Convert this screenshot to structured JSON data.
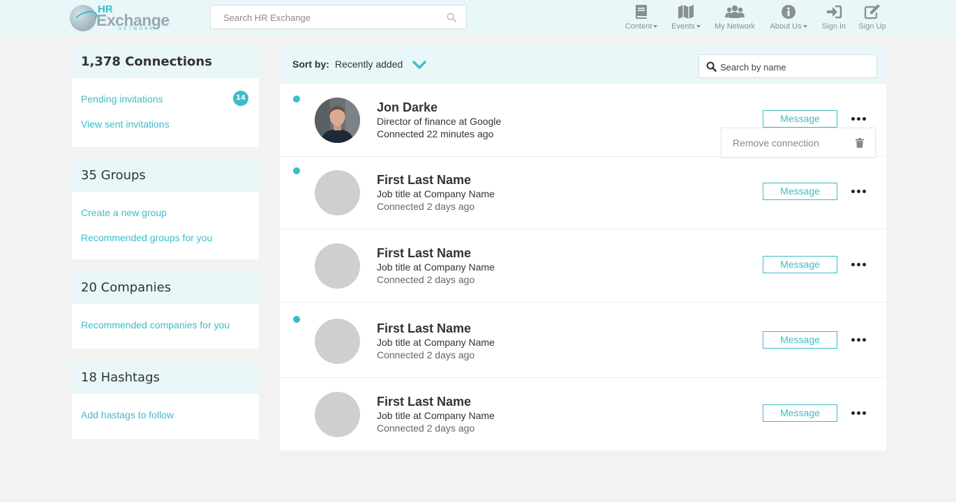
{
  "header": {
    "logo": {
      "line1": "HR",
      "line2": "Exchange",
      "line3": "NETWORK"
    },
    "search_placeholder": "Search HR Exchange",
    "nav": [
      {
        "label": "Content",
        "icon": "book-icon",
        "dropdown": true
      },
      {
        "label": "Events",
        "icon": "map-icon",
        "dropdown": true
      },
      {
        "label": "My Network",
        "icon": "users-icon",
        "dropdown": false
      },
      {
        "label": "About Us",
        "icon": "info-icon",
        "dropdown": true
      },
      {
        "label": "Sign In",
        "icon": "sign-in-icon",
        "dropdown": false
      },
      {
        "label": "Sign Up",
        "icon": "edit-icon",
        "dropdown": false
      }
    ]
  },
  "sidebar": {
    "connections": {
      "title": "1,378 Connections",
      "pending_label": "Pending invitations",
      "pending_count": "14",
      "sent_label": "View sent invitations"
    },
    "groups": {
      "title": "35 Groups",
      "create_label": "Create a new group",
      "recommended_label": "Recommended groups for you"
    },
    "companies": {
      "title": "20 Companies",
      "recommended_label": "Recommended companies for you"
    },
    "hashtags": {
      "title": "18 Hashtags",
      "follow_label": "Add hastags to follow"
    }
  },
  "main": {
    "sort_label": "Sort by:",
    "sort_value": "Recently added",
    "name_search_placeholder": "Search by name",
    "message_label": "Message",
    "remove_label": "Remove connection",
    "connections": [
      {
        "name": "Jon Darke",
        "title": "Director of finance at Google",
        "connected": "Connected 22 minutes ago",
        "unread": true,
        "photo": true
      },
      {
        "name": "First Last Name",
        "title": "Job title at Company Name",
        "connected": "Connected 2 days ago",
        "unread": true,
        "photo": false
      },
      {
        "name": "First Last Name",
        "title": "Job title at Company Name",
        "connected": "Connected 2 days ago",
        "unread": false,
        "photo": false
      },
      {
        "name": "First Last Name",
        "title": "Job title at Company Name",
        "connected": "Connected 2 days ago",
        "unread": true,
        "photo": false
      },
      {
        "name": "First Last Name",
        "title": "Job title at Company Name",
        "connected": "Connected 2 days ago",
        "unread": false,
        "photo": false
      }
    ]
  },
  "colors": {
    "accent": "#3bbdc9",
    "header_bg": "#e9f7f9",
    "page_bg": "#f2f2f2"
  }
}
